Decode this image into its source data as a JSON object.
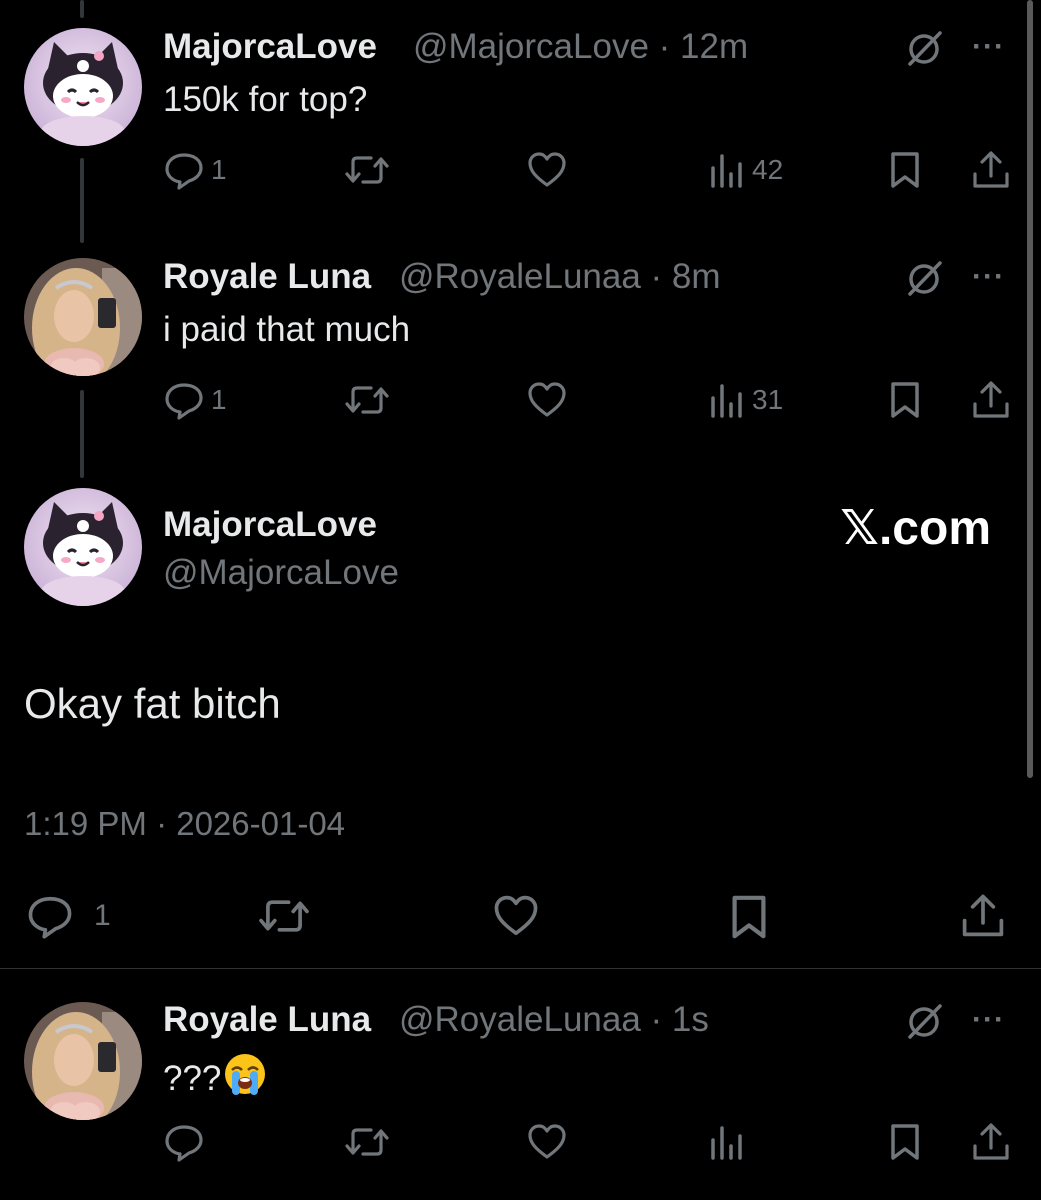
{
  "replies": [
    {
      "name": "MajorcaLove",
      "handle": "@MajorcaLove",
      "sep": " · ",
      "time": "12m",
      "text": "150k for top?",
      "reply_count": "1",
      "view_count": "42"
    },
    {
      "name": "Royale Luna",
      "handle": "@RoyaleLunaa",
      "sep": " · ",
      "time": "8m",
      "text": "i paid that much",
      "reply_count": "1",
      "view_count": "31"
    }
  ],
  "main_tweet": {
    "name": "MajorcaLove",
    "handle": "@MajorcaLove",
    "text": "Okay fat bitch",
    "timestamp": "1:19 PM · 2026-01-04",
    "reply_count": "1",
    "brand_text": ".com",
    "brand_x": "𝕏"
  },
  "last_reply": {
    "name": "Royale Luna",
    "handle": "@RoyaleLunaa",
    "sep": " · ",
    "time": "1s",
    "text": "???"
  },
  "icons": {
    "reply": "reply-icon",
    "retweet": "retweet-icon",
    "like": "heart-icon",
    "views": "views-icon",
    "bookmark": "bookmark-icon",
    "share": "share-icon",
    "grok": "grok-icon",
    "more": "more-icon",
    "emoji": "loudly-crying-face-emoji"
  },
  "more_label": "···",
  "colors": {
    "background": "#000000",
    "text": "#e7e9ea",
    "secondary": "#71767b",
    "divider": "#2f3336"
  }
}
